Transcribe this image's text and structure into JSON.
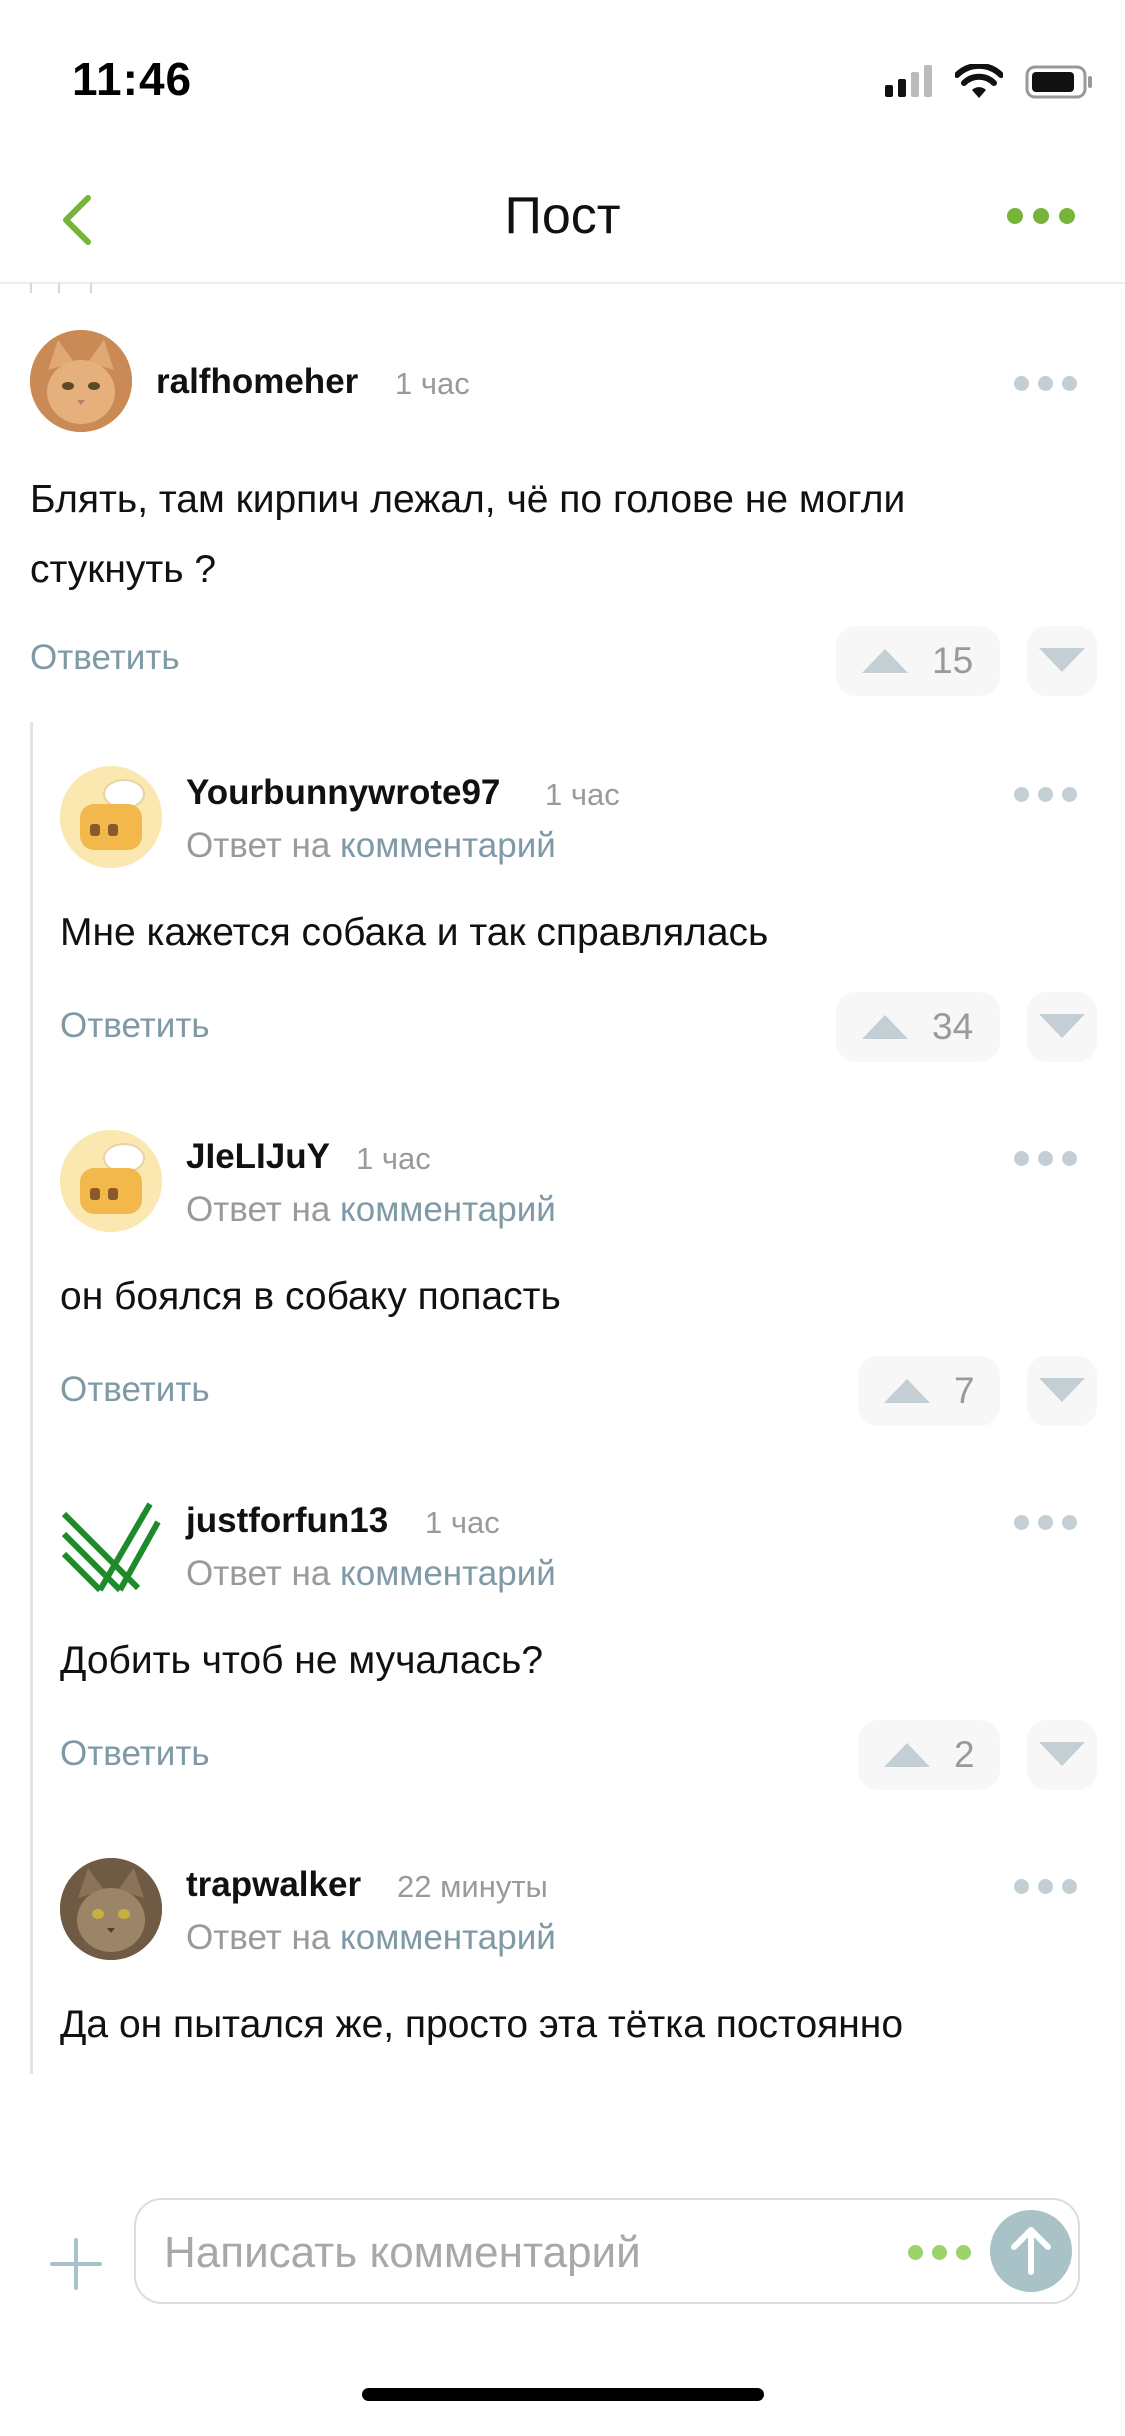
{
  "status_bar": {
    "time": "11:46"
  },
  "nav": {
    "title": "Пост"
  },
  "colors": {
    "accent": "#76b53a",
    "link": "#7f9aa6",
    "meta": "#9a9a9a"
  },
  "comments": [
    {
      "username": "ralfhomeher",
      "time": "1 час",
      "text_lines": [
        "Блять, там кирпич лежал, чё по голове не могли",
        "стукнуть ?"
      ],
      "reply_label": "Ответить",
      "votes": "15",
      "avatar_icon": "cat-avatar"
    },
    {
      "username": "Yourbunnywrote97",
      "time": "1 час",
      "reply_to_prefix": "Ответ на",
      "reply_to_link": "комментарий",
      "text": "Мне кажется собака и так справлялась",
      "reply_label": "Ответить",
      "votes": "34",
      "avatar_icon": "toaster-avatar"
    },
    {
      "username": "JIeLIJuY",
      "time": "1 час",
      "reply_to_prefix": "Ответ на",
      "reply_to_link": "комментарий",
      "text": "он боялся в собаку попасть",
      "reply_label": "Ответить",
      "votes": "7",
      "avatar_icon": "toaster-avatar"
    },
    {
      "username": "justforfun13",
      "time": "1 час",
      "reply_to_prefix": "Ответ на",
      "reply_to_link": "комментарий",
      "text": "Добить чтоб не мучалась?",
      "reply_label": "Ответить",
      "votes": "2",
      "avatar_icon": "green-stripes-avatar"
    },
    {
      "username": "trapwalker",
      "time": "22 минуты",
      "reply_to_prefix": "Ответ на",
      "reply_to_link": "комментарий",
      "text": "Да он пытался же, просто эта тётка постоянно",
      "avatar_icon": "cat-avatar"
    }
  ],
  "composer": {
    "placeholder": "Написать комментарий"
  }
}
